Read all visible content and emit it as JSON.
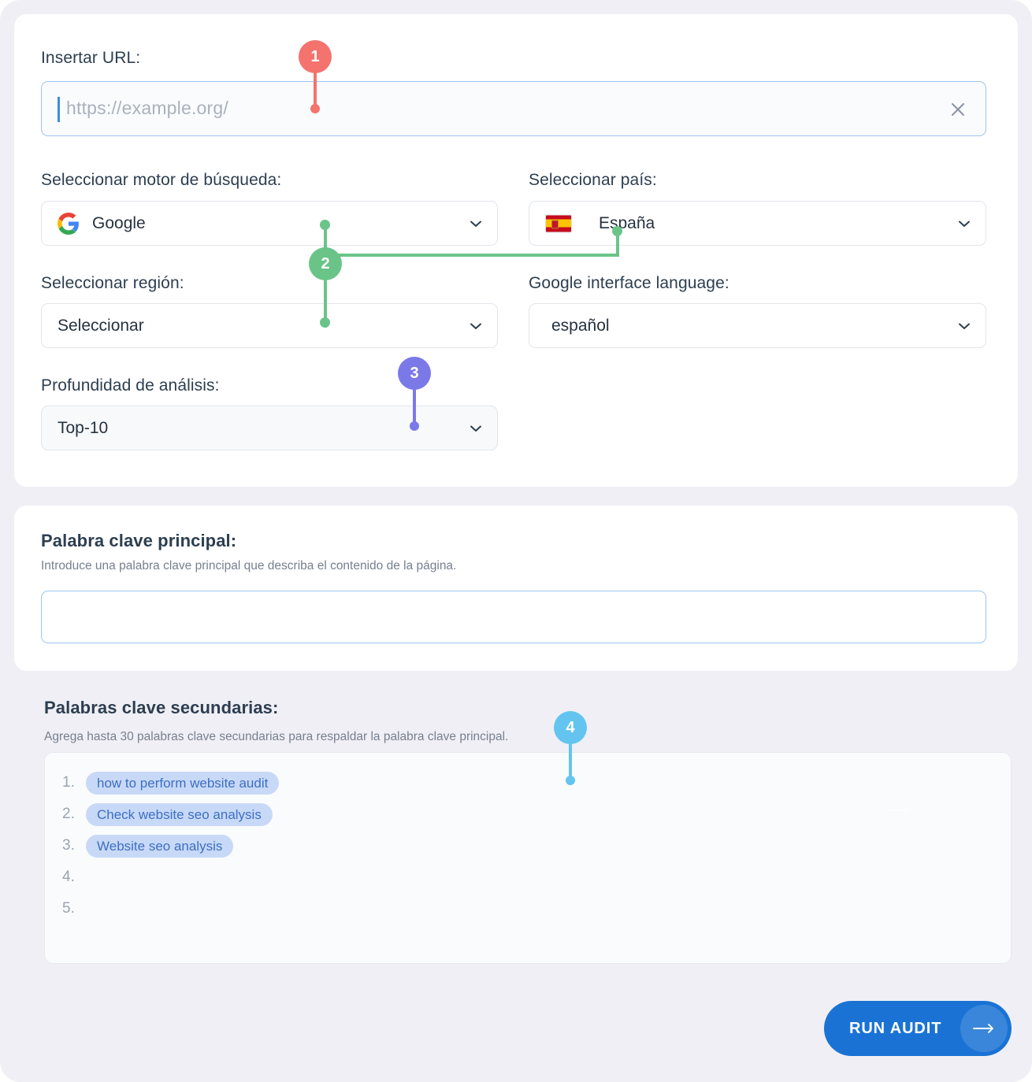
{
  "colors": {
    "page_background": "#f0eff5",
    "card_background": "#ffffff",
    "label_text": "#2d3e50",
    "muted_text": "#76808f",
    "input_border_active": "#9dc6ef",
    "select_border": "#e2e5ec",
    "chip_background": "#c7d9f7",
    "chip_text": "#3d6fc4",
    "primary_button": "#1a73d4",
    "badge_1": "#f4736e",
    "badge_2": "#6ac488",
    "badge_3": "#7b79e8",
    "badge_4": "#63c5ef"
  },
  "settings": {
    "url": {
      "label": "Insertar URL:",
      "value": "",
      "placeholder": "https://example.org/",
      "clear_icon": "close-x-icon"
    },
    "search_engine": {
      "label": "Seleccionar motor de búsqueda:",
      "value": "Google",
      "icon": "google-logo-icon",
      "chevron": "chevron-down-icon"
    },
    "country": {
      "label": "Seleccionar país:",
      "value": "España",
      "icon": "spain-flag-icon",
      "chevron": "chevron-down-icon"
    },
    "region": {
      "label": "Seleccionar región:",
      "value": "Seleccionar",
      "chevron": "chevron-down-icon"
    },
    "interface_language": {
      "label": "Google interface language:",
      "value": "español",
      "chevron": "chevron-down-icon"
    },
    "depth": {
      "label": "Profundidad de análisis:",
      "value": "Top-10",
      "chevron": "chevron-down-icon"
    }
  },
  "main_keyword": {
    "title": "Palabra clave principal:",
    "description": "Introduce una palabra clave principal que describa el contenido de la página.",
    "value": ""
  },
  "secondary_keywords": {
    "title": "Palabras clave secundarias:",
    "description": "Agrega hasta 30 palabras clave secundarias para respaldar la palabra clave principal.",
    "rows": [
      {
        "number": "1.",
        "keyword": "how to perform website audit"
      },
      {
        "number": "2.",
        "keyword": "Check website seo analysis"
      },
      {
        "number": "3.",
        "keyword": "Website seo analysis"
      },
      {
        "number": "4.",
        "keyword": ""
      },
      {
        "number": "5.",
        "keyword": ""
      }
    ]
  },
  "run_audit": {
    "label": "RUN AUDIT",
    "arrow_icon": "arrow-right-icon"
  },
  "callouts": [
    {
      "number": "1",
      "target": "url-field"
    },
    {
      "number": "2",
      "target": "search-engine-region-country"
    },
    {
      "number": "3",
      "target": "depth-select"
    },
    {
      "number": "4",
      "target": "secondary-keywords-box"
    }
  ]
}
